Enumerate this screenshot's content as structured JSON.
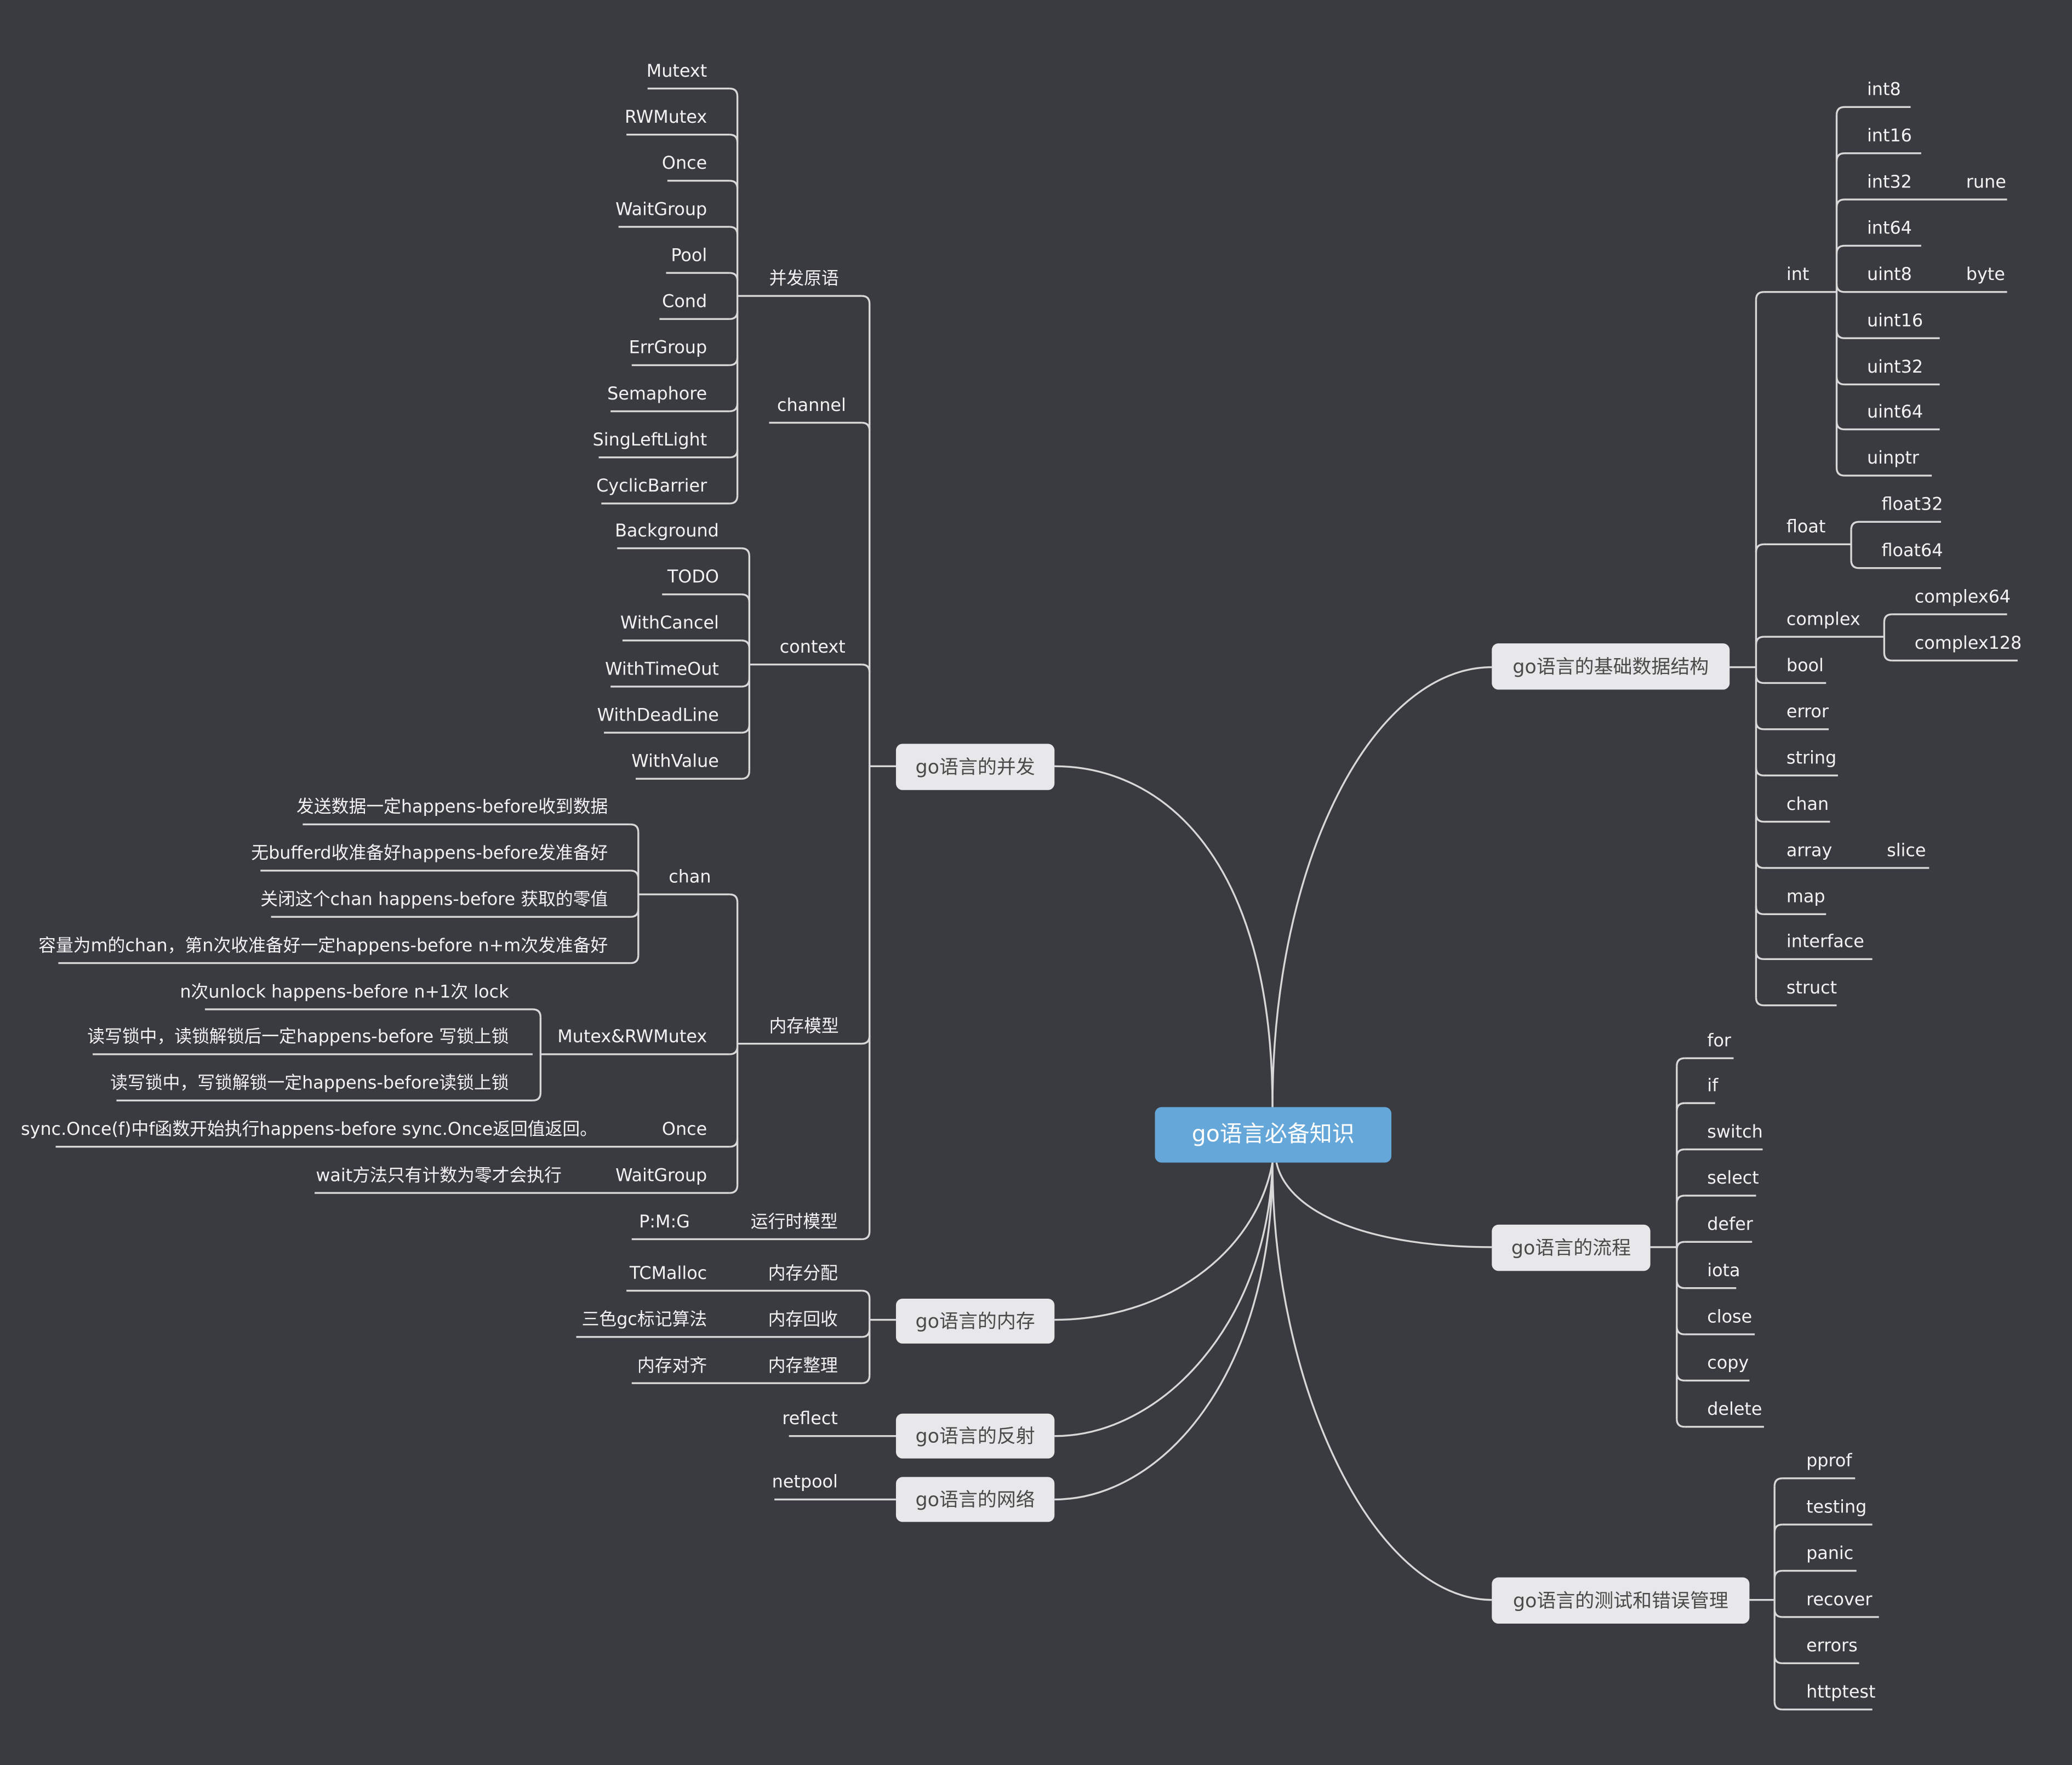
{
  "title": "go语言必备知识",
  "colors": {
    "background": "#3a3b41",
    "root_fill": "#65a7d8",
    "topic_fill": "#e8e8ea",
    "line": "#d8d8d8",
    "text_light": "#f2f2f2",
    "topic_text": "#4a4a4a"
  },
  "root": {
    "label": "go语言必备知识"
  },
  "topics": {
    "concurrency": {
      "label": "go语言的并发",
      "children": {
        "primitives": {
          "label": "并发原语",
          "items": [
            "Mutext",
            "RWMutex",
            "Once",
            "WaitGroup",
            "Pool",
            "Cond",
            "ErrGroup",
            "Semaphore",
            "SingLeftLight",
            "CyclicBarrier"
          ]
        },
        "channel": {
          "label": "channel"
        },
        "context": {
          "label": "context",
          "items": [
            "Background",
            "TODO",
            "WithCancel",
            "WithTimeOut",
            "WithDeadLine",
            "WithValue"
          ]
        },
        "memory_model": {
          "label": "内存模型",
          "chan": {
            "label": "chan",
            "items": [
              "发送数据一定happens-before收到数据",
              "无bufferd收准备好happens-before发准备好",
              "关闭这个chan happens-before 获取的零值",
              "容量为m的chan，第n次收准备好一定happens-before n+m次发准备好"
            ]
          },
          "mutex": {
            "label": "Mutex&RWMutex",
            "items": [
              "n次unlock happens-before n+1次 lock",
              "读写锁中，读锁解锁后一定happens-before 写锁上锁",
              "读写锁中，写锁解锁一定happens-before读锁上锁"
            ]
          },
          "once": {
            "label": "Once",
            "items": [
              "sync.Once(f)中f函数开始执行happens-before sync.Once返回值返回。"
            ]
          },
          "waitgroup": {
            "label": "WaitGroup",
            "items": [
              "wait方法只有计数为零才会执行"
            ]
          }
        },
        "runtime_model": {
          "label": "运行时模型",
          "items": [
            "P:M:G"
          ]
        }
      }
    },
    "memory": {
      "label": "go语言的内存",
      "children": [
        {
          "label": "内存分配",
          "items": [
            "TCMalloc"
          ]
        },
        {
          "label": "内存回收",
          "items": [
            "三色gc标记算法"
          ]
        },
        {
          "label": "内存整理",
          "items": [
            "内存对齐"
          ]
        }
      ]
    },
    "reflection": {
      "label": "go语言的反射",
      "children": [
        {
          "label": "reflect"
        }
      ]
    },
    "network": {
      "label": "go语言的网络",
      "children": [
        {
          "label": "netpool"
        }
      ]
    },
    "basic_types": {
      "label": "go语言的基础数据结构",
      "children": [
        {
          "label": "int",
          "items": [
            {
              "label": "int8"
            },
            {
              "label": "int16"
            },
            {
              "label": "int32",
              "alias": "rune"
            },
            {
              "label": "int64"
            },
            {
              "label": "uint8",
              "alias": "byte"
            },
            {
              "label": "uint16"
            },
            {
              "label": "uint32"
            },
            {
              "label": "uint64"
            },
            {
              "label": "uinptr"
            }
          ]
        },
        {
          "label": "float",
          "items": [
            {
              "label": "float32"
            },
            {
              "label": "float64"
            }
          ]
        },
        {
          "label": "complex",
          "items": [
            {
              "label": "complex64"
            },
            {
              "label": "complex128"
            }
          ]
        },
        {
          "label": "bool"
        },
        {
          "label": "error"
        },
        {
          "label": "string"
        },
        {
          "label": "chan"
        },
        {
          "label": "array",
          "items": [
            {
              "label": "slice"
            }
          ]
        },
        {
          "label": "map"
        },
        {
          "label": "interface"
        },
        {
          "label": "struct"
        }
      ]
    },
    "flow": {
      "label": "go语言的流程",
      "children": [
        "for",
        "if",
        "switch",
        "select",
        "defer",
        "iota",
        "close",
        "copy",
        "delete"
      ]
    },
    "testing": {
      "label": "go语言的测试和错误管理",
      "children": [
        "pprof",
        "testing",
        "panic",
        "recover",
        "errors",
        "httptest"
      ]
    }
  }
}
